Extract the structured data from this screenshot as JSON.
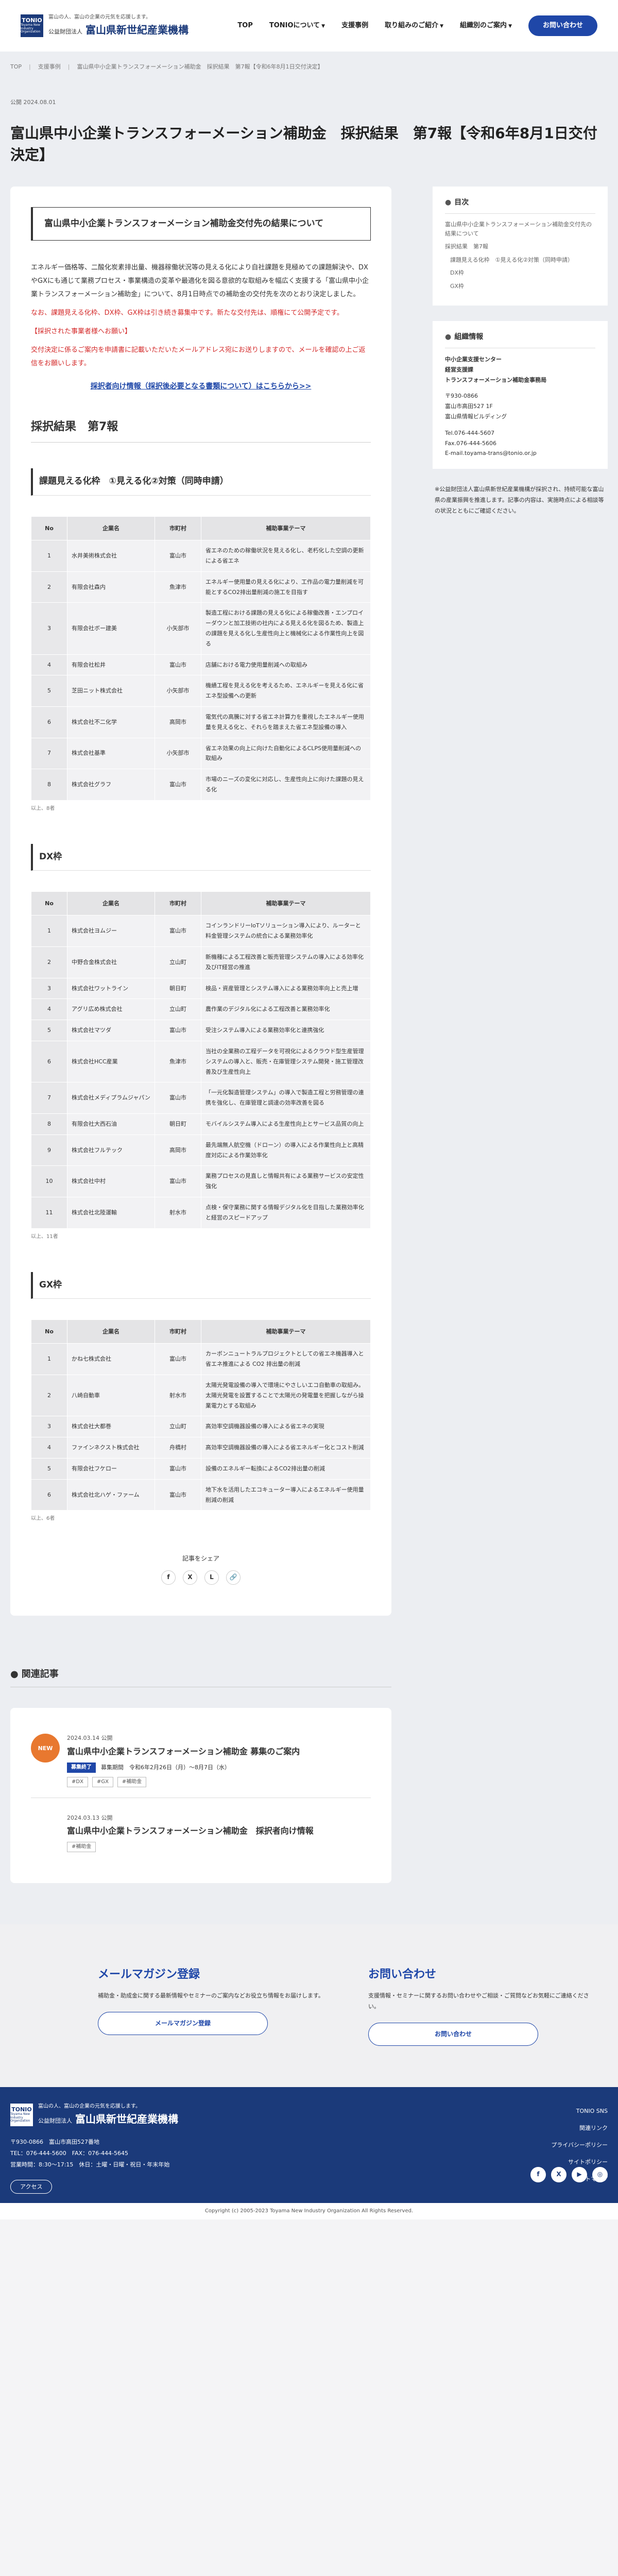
{
  "header": {
    "logo_mark": "TONIO",
    "logo_mark_sub": "Toyama New Industry Organization",
    "tagline": "富山の人、富山の企業の元気を応援します。",
    "org_prefix": "公益財団法人",
    "org_name": "富山県新世紀産業機構",
    "nav": [
      "TOP",
      "TONIOについて",
      "支援事例",
      "取り組みのご紹介",
      "組織別のご案内"
    ],
    "contact_button": "お問い合わせ"
  },
  "breadcrumb": [
    "TOP",
    "支援事例",
    "富山県中小企業トランスフォーメーション補助金　採択結果　第7報【令和6年8月1日交付決定】"
  ],
  "article": {
    "published": "公開 2024.08.01",
    "title": "富山県中小企業トランスフォーメーション補助金　採択結果　第7報【令和6年8月1日交付決定】",
    "lead": "富山県中小企業トランスフォーメーション補助金交付先の結果について",
    "p1": "エネルギー価格等、二酸化炭素排出量、機器稼働状況等の見える化により自社課題を見極めての課題解決や、DXやGXにも通じて業務プロセス・事業構造の変革や最適化を図る意欲的な取組みを幅広く支援する「富山県中小企業トランスフォーメーション補助金」について、8月1日時点での補助金の交付先を次のとおり決定しました。",
    "p2": "なお、課題見える化枠、DX枠、GX枠は引き続き募集中です。新たな交付先は、順権にて公開予定です。",
    "p3": "【採択された事業者様へお願い】",
    "p4": "交付決定に係るご案内を申請書に記載いただいたメールアドレス宛にお送りしますので、メールを確認の上ご返信をお願いします。",
    "link": "採択者向け情報（採択後必要となる書類について）はこちらから>>",
    "h2": "採択結果　第7報",
    "table_headers": [
      "No",
      "企業名",
      "市町村",
      "補助事業テーマ"
    ],
    "sec1": {
      "title": "課題見える化枠　①見える化②対策（同時申請）",
      "rows": [
        [
          "1",
          "水井美術株式会社",
          "富山市",
          "省エネのための稼働状況を見える化し、老朽化した空調の更新による省エネ"
        ],
        [
          "2",
          "有限会社森内",
          "魚津市",
          "エネルギー使用量の見える化により、工作品の電力量削減を可能とするCO2排出量削減の施工を目指す"
        ],
        [
          "3",
          "有限会社ボー建美",
          "小矢部市",
          "製造工程における課題の見える化による稼働改善・エンプロイーダウンと加工技術の社内による見える化を図るため、製造上の課題を見える化し生産性向上と機械化による作業性向上を図る"
        ],
        [
          "4",
          "有限会社松井",
          "富山市",
          "店舗における電力使用量削減への取組み"
        ],
        [
          "5",
          "芝田ニット株式会社",
          "小矢部市",
          "機績工程を見える化を考えるため、エネルギーを見える化に省エネ型設備への更新"
        ],
        [
          "6",
          "株式会社不二化学",
          "高岡市",
          "電気代の高騰に対する省エネ計算力を重視したエネルギー使用量を見える化と、それらを踏まえた省エネ型設備の導入"
        ],
        [
          "7",
          "株式会社基準",
          "小矢部市",
          "省エネ効果の向上に向けた自動化によるCLPS使用量削減への取組み"
        ],
        [
          "8",
          "株式会社グラフ",
          "富山市",
          "市場のニーズの変化に対応し、生産性向上に向けた課題の見える化"
        ]
      ],
      "note": "以上、8者"
    },
    "sec2": {
      "title": "DX枠",
      "rows": [
        [
          "1",
          "株式会社ヨムジー",
          "富山市",
          "コインランドリーIoTソリューション導入により、ルーターと料金管理システムの統合による業務効率化"
        ],
        [
          "2",
          "中野合金株式会社",
          "立山町",
          "新機種による工程改善と販売管理システムの導入による効率化及びIT経営の推進"
        ],
        [
          "3",
          "株式会社ワットライン",
          "朝日町",
          "検品・資産管理とシステム導入による業務効率向上と売上増"
        ],
        [
          "4",
          "アグリ広め株式会社",
          "立山町",
          "農作業のデジタル化による工程改善と業務効率化"
        ],
        [
          "5",
          "株式会社マツダ",
          "富山市",
          "受注システム導入による業務効率化と連携強化"
        ],
        [
          "6",
          "株式会社HCC産業",
          "魚津市",
          "当社の全業務の工程データを可視化によるクラウド型生産管理システムの導入と、販売・在庫管理システム開発・施工管理改善及び生産性向上"
        ],
        [
          "7",
          "株式会社メディプラムジャパン",
          "富山市",
          "「一元化製造管理システム」の導入で製造工程と労務管理の連携を強化し、在庫管理と調達の効率改善を図る"
        ],
        [
          "8",
          "有限会社大西石油",
          "朝日町",
          "モバイルシステム導入による生産性向上とサービス品質の向上"
        ],
        [
          "9",
          "株式会社フルテック",
          "高岡市",
          "最先端無人航空機（ドローン）の導入による作業性向上と高精度対応による作業効率化"
        ],
        [
          "10",
          "株式会社中村",
          "富山市",
          "業務プロセスの見直しと情報共有による業務サービスの安定性強化"
        ],
        [
          "11",
          "株式会社北陸運輸",
          "射水市",
          "点検・保守業務に関する情報デジタル化を目指した業務効率化と経営のスピードアップ"
        ]
      ],
      "note": "以上、11者"
    },
    "sec3": {
      "title": "GX枠",
      "rows": [
        [
          "1",
          "かね七株式会社",
          "富山市",
          "カーボンニュートラルプロジェクトとしての省エネ機器導入と省エネ推進による CO2 排出量の削減"
        ],
        [
          "2",
          "八崎自動車",
          "射水市",
          "太陽光発電設備の導入で環境にやさしいエコ自動車の取組み。太陽光発電を設置することで太陽光の発電量を把握しながら操業電力とする取組み"
        ],
        [
          "3",
          "株式会社大都巻",
          "立山町",
          "高効率空調機器設備の導入による省エネの実現"
        ],
        [
          "4",
          "ファインネクスト株式会社",
          "舟橋村",
          "高効率空調機器設備の導入による省エネルギー化とコスト削減"
        ],
        [
          "5",
          "有限会社フケロー",
          "富山市",
          "設備のエネルギー転換によるCO2排出量の削減"
        ],
        [
          "6",
          "株式会社北ハゲ・ファーム",
          "富山市",
          "地下水を活用したエコキューター導入によるエネルギー使用量削減の削減"
        ]
      ],
      "note": "以上、6者"
    },
    "share_label": "記事をシェア",
    "share_icons": [
      "f",
      "X",
      "L",
      "🔗"
    ]
  },
  "sidebar": {
    "toc_title": "目次",
    "toc_items": [
      "富山県中小企業トランスフォーメーション補助金交付先の結果について",
      "採択結果　第7報",
      "課題見える化枠　①見える化②対策（同時申請）",
      "DX枠",
      "GX枠"
    ],
    "org_title": "組織情報",
    "org_lines": [
      "中小企業支援センター",
      "経営支援課",
      "トランスフォーメーション補助金事務局"
    ],
    "org_addr": [
      "〒930-0866",
      "富山市高田527 1F",
      "富山県情報ビルディング"
    ],
    "org_contact": [
      "Tel.076-444-5607",
      "Fax.076-444-5606",
      "E-mail.toyama-trans@tonio.or.jp"
    ],
    "note": "※公益財団法人富山県新世紀産業機構が採択され、持続可能な富山県の産業振興を推進します。記事の内容は、実施時点による相談等の状況とともにご確認ください。"
  },
  "related": {
    "title": "関連記事",
    "items": [
      {
        "badge": "NEW",
        "date": "2024.03.14 公開",
        "title": "富山県中小企業トランスフォーメーション補助金 募集のご案内",
        "tag": "募集終了",
        "deadline": "募集期間　令和6年2月26日（月）〜8月7日（水）",
        "tags": [
          "#DX",
          "#GX",
          "#補助金"
        ]
      },
      {
        "badge": "",
        "date": "2024.03.13 公開",
        "title": "富山県中小企業トランスフォーメーション補助金　採択者向け情報",
        "tag": "",
        "deadline": "",
        "tags": [
          "#補助金"
        ]
      }
    ]
  },
  "cta": {
    "mail_title": "メールマガジン登録",
    "mail_text": "補助金・助成金に関する最新情報やセミナーのご案内などお役立ち情報をお届けします。",
    "mail_btn": "メールマガジン登録",
    "contact_title": "お問い合わせ",
    "contact_text": "支援情報・セミナーに関するお問い合わせやご相談・ご質問などお気軽にご連絡ください。",
    "contact_btn": "お問い合わせ"
  },
  "footer": {
    "addr": "〒930-0866　富山市高田527番地",
    "tel": "TEL：076-444-5600　FAX：076-444-5645",
    "hours": "営業時間：8:30〜17:15　休日：土曜・日曜・祝日・年末年始",
    "access": "アクセス",
    "links": [
      "TONIO SNS",
      "関連リンク",
      "プライバシーポリシー",
      "サイトポリシー",
      "サイトマップ"
    ],
    "social": [
      "f",
      "X",
      "▶",
      "◎"
    ],
    "copyright": "Copyright (c) 2005-2023 Toyama New Industry Organization All Rights Reserved."
  }
}
